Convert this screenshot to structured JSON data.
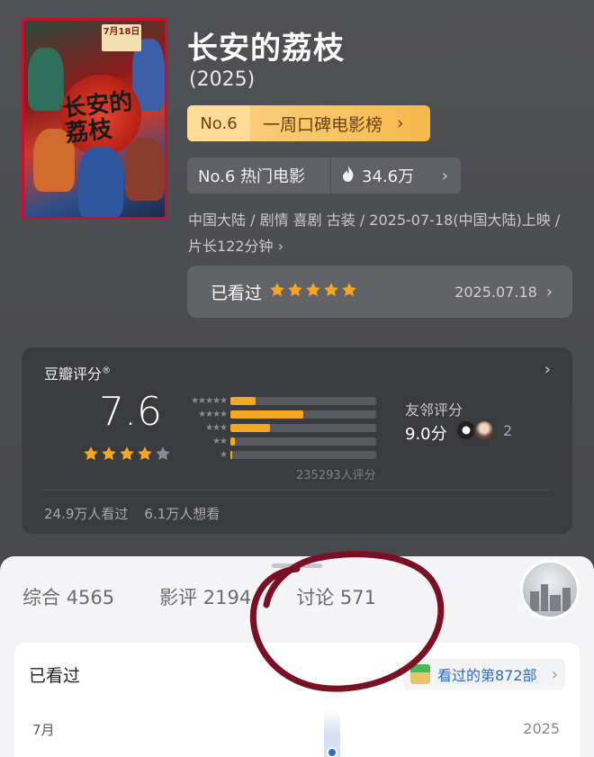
{
  "poster": {
    "date_tag": "7月18日",
    "title_text": "长安的荔枝"
  },
  "movie": {
    "title": "长安的荔枝",
    "year": "(2025)",
    "rank_num": "No.6",
    "rank_label": "一周口碑电影榜",
    "hot_rank": "No.6 热门电影",
    "hot_count": "34.6万",
    "meta": "中国大陆 / 剧情 喜剧 古装 / 2025-07-18(中国大陆)上映 / 片长122分钟",
    "meta_chevron": "›"
  },
  "user_status": {
    "label": "已看过",
    "stars": 5,
    "date": "2025.07.18"
  },
  "rating": {
    "title": "豆瓣评分",
    "title_mark": "®",
    "score": "7.6",
    "stars": 4,
    "distribution": [
      {
        "stars": "★★★★★",
        "fraction": 0.17
      },
      {
        "stars": "★★★★",
        "fraction": 0.5
      },
      {
        "stars": "★★★",
        "fraction": 0.27
      },
      {
        "stars": "★★",
        "fraction": 0.03
      },
      {
        "stars": "★",
        "fraction": 0.01
      }
    ],
    "count": "235293人评分",
    "friend_title": "友邻评分",
    "friend_score": "9.0分",
    "friend_count": "2",
    "watched": "24.9万人看过",
    "want": "6.1万人想看"
  },
  "tabs": [
    {
      "label": "综合 4565"
    },
    {
      "label": "影评 2194"
    },
    {
      "label": "讨论 571"
    }
  ],
  "card": {
    "title": "已看过",
    "badge": "看过的第872部",
    "month": "7月",
    "year": "2025"
  },
  "colors": {
    "accent_star": "#f5a623",
    "ink_circle": "#7a1024",
    "link_blue": "#2a6bd0"
  }
}
